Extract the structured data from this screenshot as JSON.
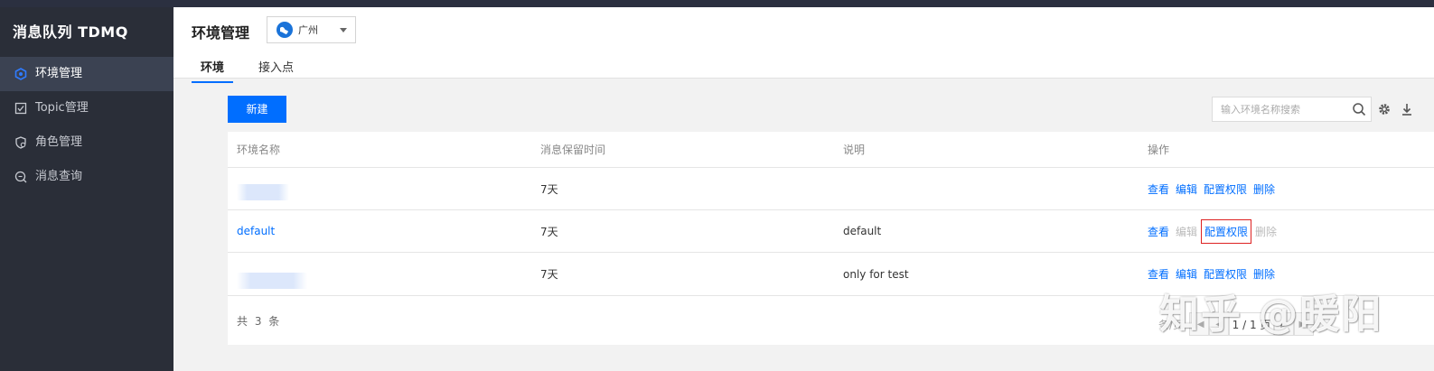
{
  "app": {
    "brand": "消息队列 TDMQ"
  },
  "sidebar": {
    "items": [
      {
        "label": "环境管理",
        "icon": "hexagon-icon",
        "active": true
      },
      {
        "label": "Topic管理",
        "icon": "checkbox-icon",
        "active": false
      },
      {
        "label": "角色管理",
        "icon": "role-shield-icon",
        "active": false
      },
      {
        "label": "消息查询",
        "icon": "search-message-icon",
        "active": false
      }
    ]
  },
  "header": {
    "title": "环境管理",
    "region": "广州",
    "tabs": [
      {
        "label": "环境",
        "active": true
      },
      {
        "label": "接入点",
        "active": false
      }
    ]
  },
  "toolbar": {
    "new_label": "新建",
    "search_placeholder": "输入环境名称搜索"
  },
  "table": {
    "columns": [
      "环境名称",
      "消息保留时间",
      "说明",
      "操作"
    ],
    "rows": [
      {
        "name": "",
        "name_redacted": true,
        "retention": "7天",
        "desc": ""
      },
      {
        "name": "default",
        "name_redacted": false,
        "retention": "7天",
        "desc": "default"
      },
      {
        "name": "",
        "name_redacted": true,
        "retention": "7天",
        "desc": "only for test"
      }
    ],
    "actions": {
      "view": "查看",
      "edit": "编辑",
      "config": "配置权限",
      "delete": "删除"
    },
    "total_text": "共 3 条",
    "pager": {
      "per_page": "条/页",
      "page": "1 / 1 页"
    }
  },
  "watermark": "知乎 @暖阳",
  "colors": {
    "accent": "#006eff",
    "sidebar_bg": "#2a2e38",
    "highlight_border": "#dd2222"
  }
}
